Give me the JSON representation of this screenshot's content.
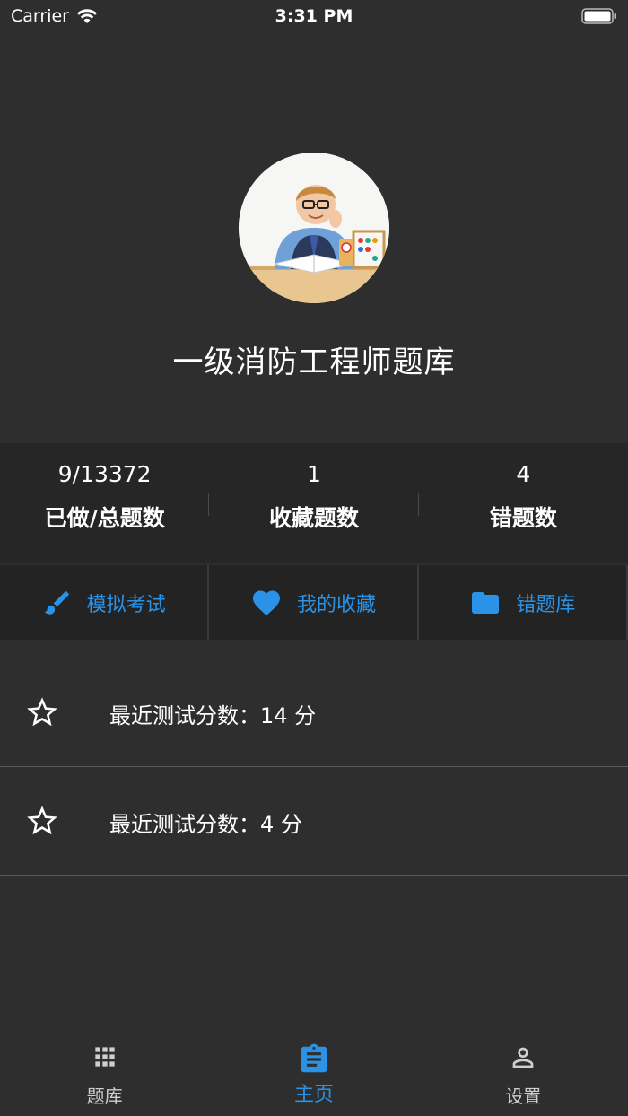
{
  "status_bar": {
    "carrier": "Carrier",
    "time": "3:31 PM"
  },
  "header": {
    "title": "一级消防工程师题库"
  },
  "stats": [
    {
      "value": "9/13372",
      "label": "已做/总题数"
    },
    {
      "value": "1",
      "label": "收藏题数"
    },
    {
      "value": "4",
      "label": "错题数"
    }
  ],
  "actions": [
    {
      "label": "模拟考试",
      "icon": "brush-icon"
    },
    {
      "label": "我的收藏",
      "icon": "heart-icon"
    },
    {
      "label": "错题库",
      "icon": "folder-icon"
    }
  ],
  "scores": [
    {
      "text": "最近测试分数：14 分",
      "icon": "star-icon"
    },
    {
      "text": "最近测试分数：4 分",
      "icon": "star-icon"
    }
  ],
  "tabs": [
    {
      "label": "题库",
      "icon": "grid-icon",
      "active": false
    },
    {
      "label": "主页",
      "icon": "clipboard-icon",
      "active": true
    },
    {
      "label": "设置",
      "icon": "person-icon",
      "active": false
    }
  ],
  "colors": {
    "background": "#2e2e2e",
    "accent": "#2a93e8",
    "stats_background": "#262626"
  }
}
